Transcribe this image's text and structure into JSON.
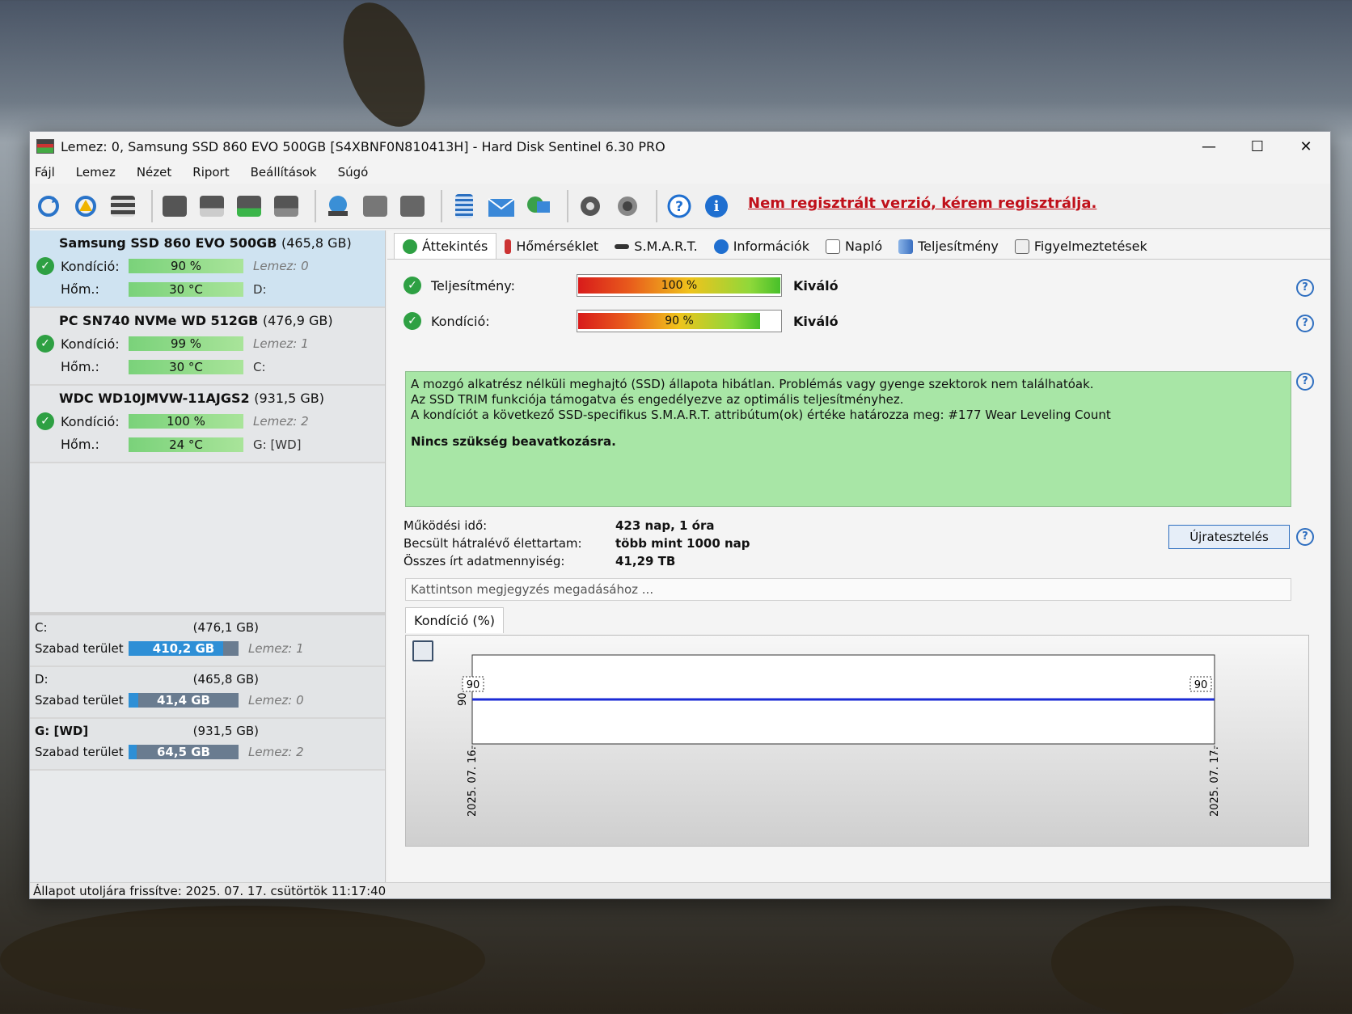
{
  "window": {
    "title": "Lemez: 0, Samsung SSD 860 EVO 500GB [S4XBNF0N810413H]  -  Hard Disk Sentinel 6.30 PRO",
    "minimize": "—",
    "maximize": "☐",
    "close": "✕"
  },
  "menu": [
    "Fájl",
    "Lemez",
    "Nézet",
    "Riport",
    "Beállítások",
    "Súgó"
  ],
  "toolbar": {
    "register_link": "Nem regisztrált verzió, kérem regisztrálja.",
    "icons": [
      "refresh-icon",
      "refresh-warning-icon",
      "disk-list-icon",
      "disk-icon",
      "disk-clock-icon",
      "disk-check-icon",
      "disk-search-icon",
      "globe-icon",
      "disks-icon",
      "export-icon",
      "report-icon",
      "mail-icon",
      "network-icon",
      "settings-icon",
      "sound-icon",
      "help-icon",
      "info-icon"
    ]
  },
  "disks": [
    {
      "name": "Samsung SSD 860 EVO 500GB",
      "size": "(465,8 GB)",
      "kondicio_label": "Kondíció:",
      "kondicio": "90 %",
      "kondicio_value": 90,
      "hom_label": "Hőm.:",
      "hom": "30 °C",
      "lemez": "Lemez: 0",
      "drive": "D:"
    },
    {
      "name": "PC SN740 NVMe WD 512GB",
      "size": "(476,9 GB)",
      "kondicio_label": "Kondíció:",
      "kondicio": "99 %",
      "kondicio_value": 99,
      "hom_label": "Hőm.:",
      "hom": "30 °C",
      "lemez": "Lemez: 1",
      "drive": "C:"
    },
    {
      "name": "WDC WD10JMVW-11AJGS2",
      "size": "(931,5 GB)",
      "kondicio_label": "Kondíció:",
      "kondicio": "100 %",
      "kondicio_value": 100,
      "hom_label": "Hőm.:",
      "hom": "24 °C",
      "lemez": "Lemez: 2",
      "drive": "G: [WD]"
    }
  ],
  "volumes": [
    {
      "name": "C:",
      "size": "(476,1 GB)",
      "free_label": "Szabad terület",
      "free": "410,2 GB",
      "free_fraction": 0.86,
      "lemez": "Lemez: 1"
    },
    {
      "name": "D:",
      "size": "(465,8 GB)",
      "free_label": "Szabad terület",
      "free": "41,4 GB",
      "free_fraction": 0.09,
      "lemez": "Lemez: 0"
    },
    {
      "name": "G: [WD]",
      "size": "(931,5 GB)",
      "free_label": "Szabad terület",
      "free": "64,5 GB",
      "free_fraction": 0.07,
      "lemez": "Lemez: 2"
    }
  ],
  "tabs": [
    "Áttekintés",
    "Hőmérséklet",
    "S.M.A.R.T.",
    "Információk",
    "Napló",
    "Teljesítmény",
    "Figyelmeztetések"
  ],
  "overview": {
    "performance": {
      "label": "Teljesítmény:",
      "value": "100 %",
      "value_num": 100,
      "rating": "Kiváló"
    },
    "condition": {
      "label": "Kondíció:",
      "value": "90 %",
      "value_num": 90,
      "rating": "Kiváló"
    },
    "status_lines": [
      "A mozgó alkatrész nélküli meghajtó (SSD) állapota hibátlan. Problémás vagy gyenge szektorok nem találhatóak.",
      "Az SSD TRIM funkciója támogatva és engedélyezve az optimális teljesítményhez.",
      "A kondíciót a következő SSD-specifikus S.M.A.R.T. attribútum(ok) értéke határozza meg:  #177 Wear Leveling Count"
    ],
    "status_bold": "Nincs szükség beavatkozásra.",
    "info": [
      {
        "k": "Működési idő:",
        "v": "423 nap, 1 óra"
      },
      {
        "k": "Becsült hátralévő élettartam:",
        "v": "több mint 1000 nap"
      },
      {
        "k": "Összes írt adatmennyiség:",
        "v": "41,29 TB"
      }
    ],
    "retest_button": "Újratesztelés",
    "note_placeholder": "Kattintson megjegyzés megadásához ..."
  },
  "chart_tab": "Kondíció  (%)",
  "chart_data": {
    "type": "line",
    "x": [
      "2025. 07. 16.",
      "2025. 07. 17."
    ],
    "series": [
      {
        "values": [
          90,
          90
        ]
      }
    ],
    "ytick": "90",
    "point_labels": [
      "90",
      "90"
    ]
  },
  "statusbar": "Állapot utoljára frissítve: 2025. 07. 17. csütörtök 11:17:40"
}
